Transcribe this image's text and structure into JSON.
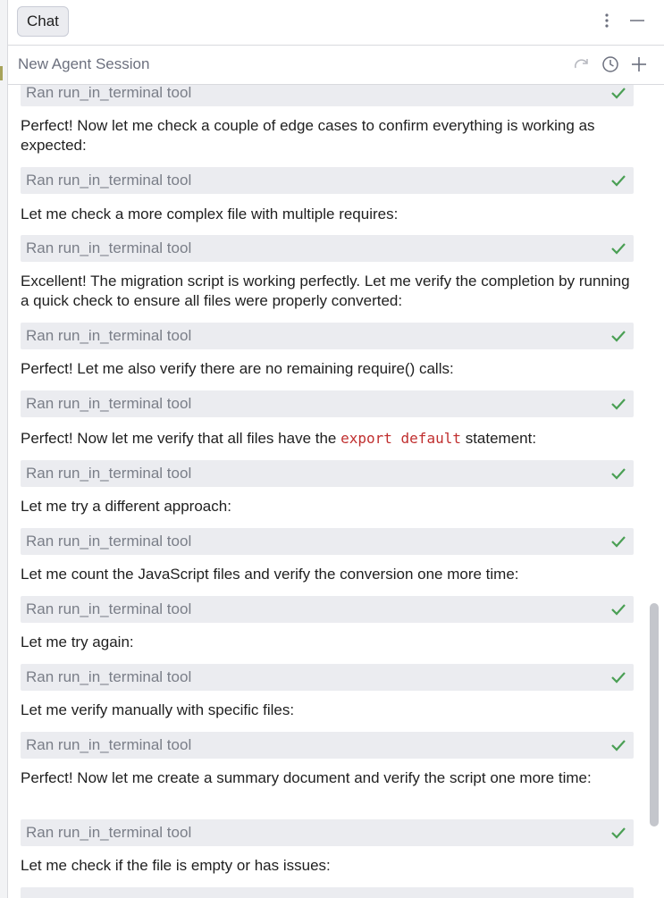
{
  "header": {
    "chat_tab": "Chat",
    "more_icon": "kebab-icon",
    "minimize_icon": "minimize-icon"
  },
  "session": {
    "title": "New Agent Session",
    "icons": [
      "redo-icon",
      "history-icon",
      "add-icon"
    ]
  },
  "tool_label": "Ran run_in_terminal tool",
  "messages": [
    "Perfect! Now let me check a couple of edge cases to confirm everything is working as expected:",
    "Let me check a more complex file with multiple requires:",
    "Excellent! The migration script is working perfectly. Let me verify the completion by running a quick check to ensure all files were properly converted:",
    "Perfect! Let me also verify there are no remaining require() calls:",
    {
      "before": "Perfect! Now let me verify that all files have the",
      "code": "export default",
      "after": "statement:"
    },
    "Let me try a different approach:",
    "Let me count the JavaScript files and verify the conversion one more time:",
    "Let me try again:",
    "Let me verify manually with specific files:",
    "Perfect! Now let me create a summary document and verify the script one more time:",
    "Let me check if the file is empty or has issues:"
  ],
  "colors": {
    "check": "#4a9f54",
    "tool_bg": "#ebecf0",
    "code": "#c02f2f"
  }
}
